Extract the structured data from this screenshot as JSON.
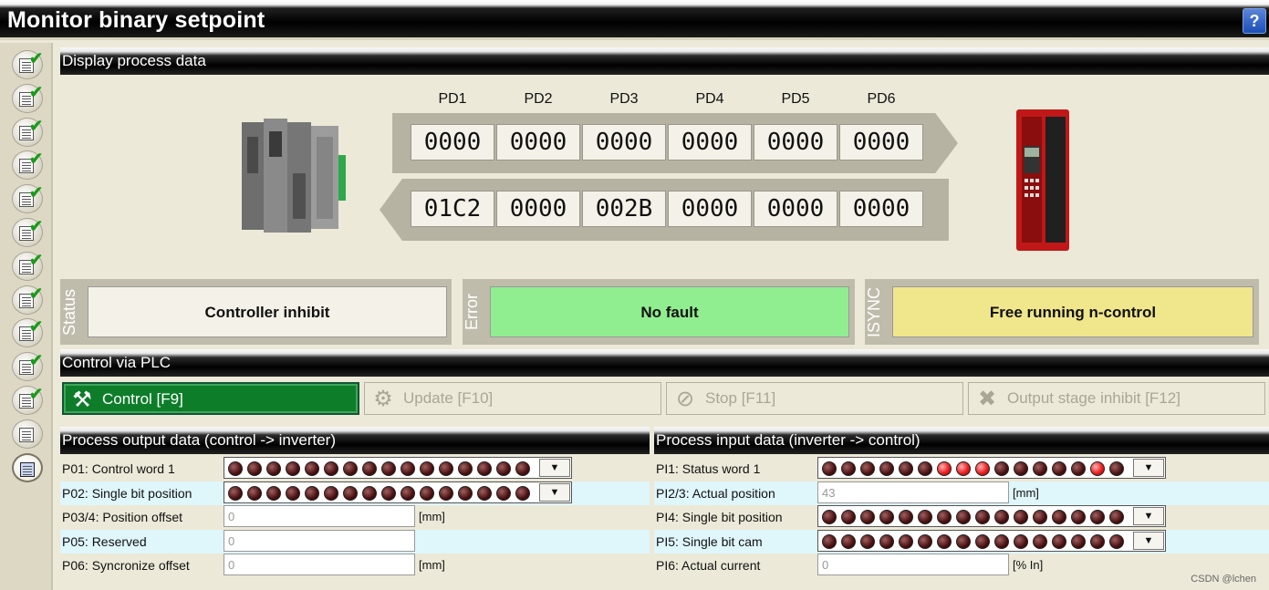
{
  "window": {
    "title": "Monitor binary setpoint",
    "help": "?"
  },
  "sidebar": {
    "count": 13,
    "active_index": 12
  },
  "display": {
    "title": "Display process data",
    "pd_labels": [
      "PD1",
      "PD2",
      "PD3",
      "PD4",
      "PD5",
      "PD6"
    ],
    "outgoing": [
      "0000",
      "0000",
      "0000",
      "0000",
      "0000",
      "0000"
    ],
    "incoming": [
      "01C2",
      "0000",
      "002B",
      "0000",
      "0000",
      "0000"
    ]
  },
  "status": {
    "status_label": "Status",
    "status_value": "Controller inhibit",
    "error_label": "Error",
    "error_value": "No fault",
    "isync_label": "ISYNC",
    "isync_value": "Free running n-control",
    "colors": {
      "status": "#f4f2e8",
      "error": "#90ee90",
      "isync": "#f0e68c"
    }
  },
  "control": {
    "title": "Control via PLC",
    "buttons": [
      {
        "label": "Control  [F9]",
        "icon": "control-icon",
        "active": true
      },
      {
        "label": "Update  [F10]",
        "icon": "gear-icon",
        "active": false
      },
      {
        "label": "Stop  [F11]",
        "icon": "stop-icon",
        "active": false
      },
      {
        "label": "Output stage inhibit  [F12]",
        "icon": "cross-icon",
        "active": false
      }
    ]
  },
  "output": {
    "title": "Process output data (control -> inverter)",
    "rows": [
      {
        "label": "P01: Control word 1",
        "kind": "leds",
        "on": []
      },
      {
        "label": "P02: Single bit position",
        "kind": "leds",
        "on": []
      },
      {
        "label": "P03/4: Position offset",
        "kind": "field",
        "value": "0",
        "unit": "[mm]"
      },
      {
        "label": "P05: Reserved",
        "kind": "field",
        "value": "0",
        "unit": ""
      },
      {
        "label": "P06: Syncronize offset",
        "kind": "field",
        "value": "0",
        "unit": "[mm]"
      }
    ]
  },
  "input": {
    "title": "Process input data (inverter -> control)",
    "rows": [
      {
        "label": "PI1: Status word 1",
        "kind": "leds",
        "on": [
          6,
          7,
          8,
          14
        ]
      },
      {
        "label": "PI2/3: Actual position",
        "kind": "field",
        "value": "43",
        "unit": "[mm]"
      },
      {
        "label": "PI4: Single bit position",
        "kind": "leds",
        "on": []
      },
      {
        "label": "PI5: Single bit cam",
        "kind": "leds",
        "on": []
      },
      {
        "label": "PI6: Actual current",
        "kind": "field",
        "value": "0",
        "unit": "[% In]"
      }
    ]
  },
  "watermark": "CSDN @lchen"
}
